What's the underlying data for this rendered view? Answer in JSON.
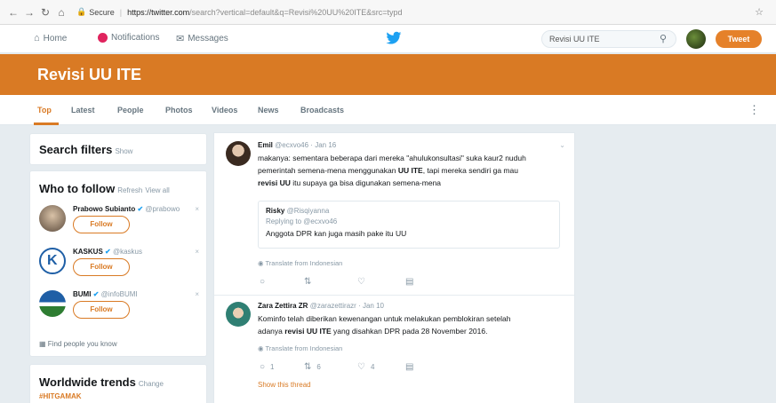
{
  "browser": {
    "secure_label": "Secure",
    "url_host": "https://twitter.com",
    "url_rest": "/search?vertical=default&q=Revisi%20UU%20ITE&src=typd"
  },
  "nav": {
    "home": "Home",
    "notifications": "Notifications",
    "messages": "Messages",
    "search_value": "Revisi UU ITE",
    "tweet_button": "Tweet"
  },
  "banner": {
    "title": "Revisi UU ITE"
  },
  "tabs": [
    "Top",
    "Latest",
    "People",
    "Photos",
    "Videos",
    "News",
    "Broadcasts"
  ],
  "search_filters": {
    "title": "Search filters",
    "show": "Show"
  },
  "who_to_follow": {
    "title": "Who to follow",
    "refresh": "Refresh",
    "view_all": "View all",
    "follow_label": "Follow",
    "accounts": [
      {
        "name": "Prabowo Subianto",
        "handle": "@prabowo"
      },
      {
        "name": "KASKUS",
        "handle": "@kaskus"
      },
      {
        "name": "BUMI",
        "handle": "@infoBUMI"
      }
    ],
    "find_people": "Find people you know"
  },
  "trends": {
    "title": "Worldwide trends",
    "change": "Change",
    "first": "#HITGAMAK"
  },
  "tweets": [
    {
      "name": "Emil",
      "handle": "@ecxvo46",
      "date": "Jan 16",
      "body_1": "makanya: sementara beberapa dari mereka \"ahulu",
      "body_1b": "konsultasi\" suka kaur2 nuduh",
      "body_2a": "pemerintah semena-mena menggunakan ",
      "body_2b": "UU ITE",
      "body_2c": ", tapi mereka sendiri ga mau",
      "body_3a": "revisi UU",
      "body_3b": " itu supaya ga bisa digunakan semena-mena",
      "quote": {
        "name": "Risky",
        "handle": "@Risqiyanna",
        "replying": "Replying to @ecxvo46",
        "text": "Anggota DPR kan juga masih pake itu UU"
      },
      "translate": "Translate from Indonesian"
    },
    {
      "name": "Zara Zettira ZR",
      "handle": "@zarazettirazr",
      "date": "Jan 10",
      "body_1": "Kominfo telah diberikan kewenangan untuk melakukan pemblokiran setelah",
      "body_2a": "adanya ",
      "body_2b": "revisi UU ITE",
      "body_2c": " yang disahkan DPR pada 28 November 2016.",
      "translate": "Translate from Indonesian",
      "replies": "1",
      "retweets": "6",
      "likes": "4",
      "show_thread": "Show this thread"
    }
  ],
  "colors": {
    "accent": "#d97a24",
    "twitter_blue": "#1da1f2"
  },
  "icons": [
    "back-icon",
    "forward-icon",
    "reload-icon",
    "home-icon",
    "lock-icon",
    "bell-icon",
    "mail-icon",
    "bird-icon",
    "search-icon",
    "reply-icon",
    "retweet-icon",
    "like-icon",
    "dm-icon",
    "globe-icon",
    "verified-icon"
  ]
}
